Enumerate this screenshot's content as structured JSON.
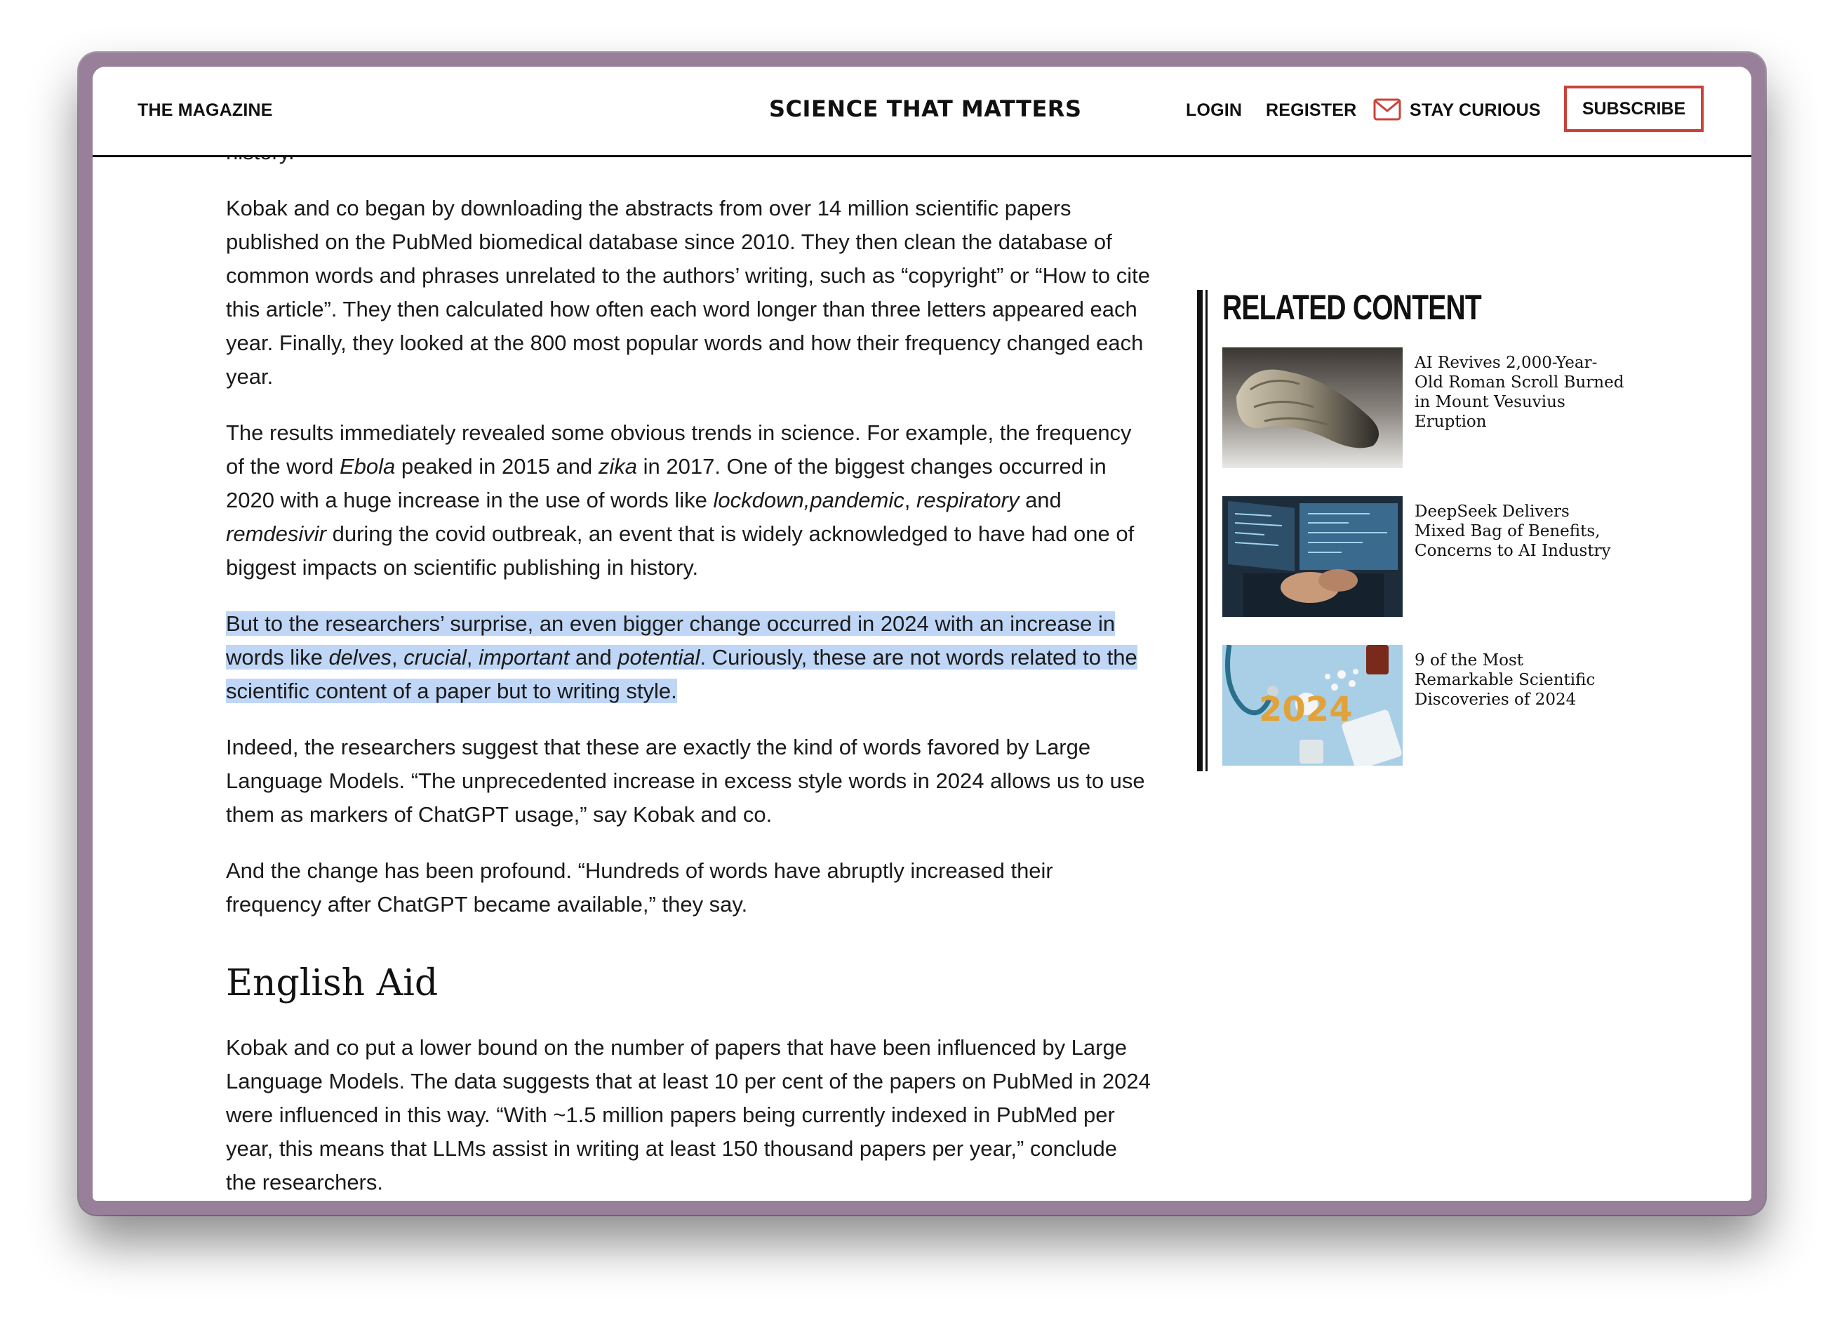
{
  "header": {
    "magazine_label": "THE MAGAZINE",
    "brand": "SCIENCE THAT MATTERS",
    "login": "LOGIN",
    "register": "REGISTER",
    "stay_curious": "STAY CURIOUS",
    "subscribe": "SUBSCRIBE",
    "envelope_icon": "envelope-icon",
    "accent_color": "#c9433a"
  },
  "article": {
    "top_fragment": "history.",
    "p1": "Kobak and co began by downloading the abstracts from over 14 million scientific papers published on the PubMed biomedical database since 2010. They then clean the database of common words and phrases unrelated to the authors’ writing, such as “copyright” or “How to cite this article”. They then calculated how often each word longer than three letters appeared each year. Finally, they looked at the 800 most popular words and how their frequency changed each year.",
    "p2": {
      "a": "The results immediately revealed some obvious trends in science. For example, the frequency of the word ",
      "ebola": "Ebola",
      "b": " peaked in 2015 and ",
      "zika": "zika",
      "c": " in 2017. One of the biggest changes occurred in 2020 with a huge increase in the use of words like ",
      "lockdown": "lockdown,",
      "pandemic": "pandemic",
      "comma": ",",
      "respiratory": "respiratory",
      "and": " and ",
      "remdesivir": "remdesivir",
      "d": " during the covid outbreak, an event that is widely acknowledged to have had one of biggest impacts on scientific publishing in history."
    },
    "p3": {
      "a": "But to the researchers’ surprise, an even bigger change occurred in 2024 with an increase in words like ",
      "delves": "delves",
      "sep1": ", ",
      "crucial": "crucial",
      "sep2": ", ",
      "important": "important",
      "and": " and ",
      "potential": "potential",
      "b": ". Curiously, these are not words related to the scientific content of a paper but to writing style."
    },
    "p4": "Indeed, the researchers suggest that these are exactly the kind of words favored by Large Language Models. “The unprecedented increase in excess style words in 2024 allows us to use them as markers of ChatGPT usage,” say Kobak and co.",
    "p5": "And the change has been profound. “Hundreds of words have abruptly increased their frequency after ChatGPT became available,” they say.",
    "heading": "English Aid",
    "p6": "Kobak and co put a lower bound on the number of papers that have been influenced by Large Language Models. The data suggests that at least 10 per cent of the papers on PubMed in 2024 were influenced in this way. “With ~1.5 million papers being currently indexed in PubMed per year, this means that LLMs assist in writing at least 150 thousand papers per year,” conclude the researchers.",
    "highlight_color": "#bfd6f6"
  },
  "sidebar": {
    "title": "RELATED CONTENT",
    "items": [
      {
        "title": "AI Revives 2,000-Year-Old Roman Scroll Burned in Mount Vesuvius Eruption",
        "thumb": "scroll-photo"
      },
      {
        "title": "DeepSeek Delivers Mixed Bag of Benefits, Concerns to AI Industry",
        "thumb": "computer-screens-photo"
      },
      {
        "title": "9 of the Most Remarkable Scientific Discoveries of 2024",
        "thumb": "medical-2024-photo",
        "thumb_text": "2024"
      }
    ]
  }
}
